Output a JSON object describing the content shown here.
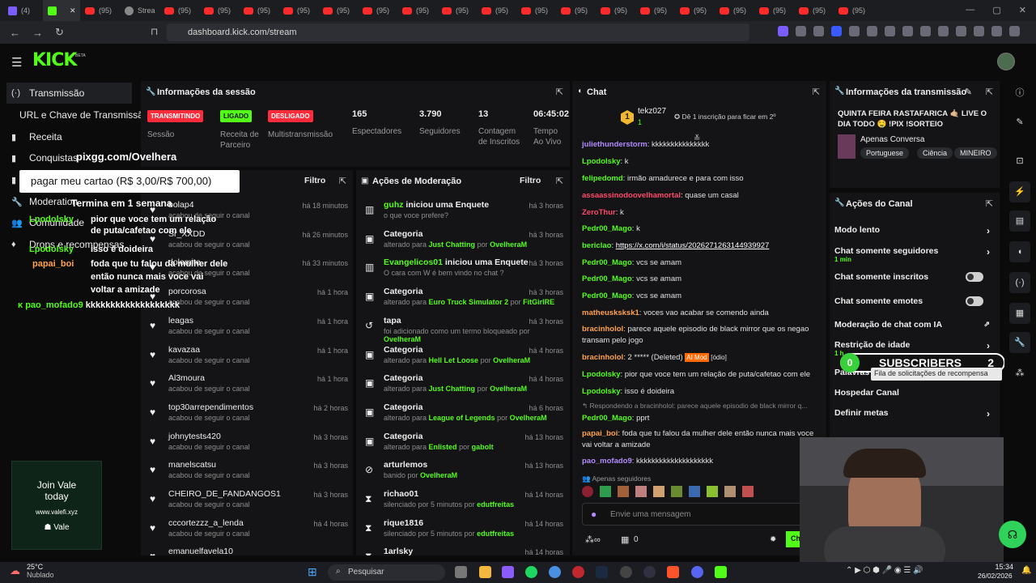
{
  "browser": {
    "tabs": [
      {
        "label": "(4)"
      },
      {
        "label": ""
      },
      {
        "label": "(95)"
      },
      {
        "label": "Strea"
      },
      {
        "label": "(95)"
      },
      {
        "label": "(95)"
      },
      {
        "label": "(95)"
      },
      {
        "label": "(95)"
      },
      {
        "label": "(95)"
      },
      {
        "label": "(95)"
      },
      {
        "label": "(95)"
      },
      {
        "label": "(95)"
      },
      {
        "label": "(95)"
      },
      {
        "label": "(95)"
      },
      {
        "label": "(95)"
      },
      {
        "label": "(95)"
      },
      {
        "label": "(95)"
      },
      {
        "label": "(95)"
      },
      {
        "label": "(95)"
      },
      {
        "label": "(95)"
      },
      {
        "label": "(95)"
      },
      {
        "label": "(95)"
      }
    ],
    "url": "dashboard.kick.com/stream"
  },
  "header": {
    "logo": "KICK",
    "beta": "BETA"
  },
  "sidebar": {
    "items": [
      {
        "label": "Transmissão",
        "icon": "(·)"
      },
      {
        "label": "URL e Chave de Transmissão",
        "icon": ""
      },
      {
        "label": "Receita",
        "icon": "▮"
      },
      {
        "label": "Conquistas",
        "icon": "▮"
      },
      {
        "label": "",
        "icon": "▮"
      },
      {
        "label": "Moderation",
        "icon": "🔧"
      },
      {
        "label": "Comunidade",
        "icon": "👥"
      },
      {
        "label": "Drops e recompensas",
        "icon": "♦"
      }
    ],
    "ad": {
      "line1": "Join Vale",
      "line2": "today",
      "line3": "www.valefi.xyz",
      "line4": "Vale"
    }
  },
  "overlay": {
    "pix": "pixgg.com/Ovelhera",
    "pay": "pagar meu cartao (R$ 3,00/R$ 700,00)",
    "countdown": "Termina em 1 semana",
    "chat": [
      {
        "u": "Lpodolsky",
        "m": "pior que voce tem um relação de puta/cafetao com ele"
      },
      {
        "u": "Lpodolsky",
        "m": "isso é doideira"
      },
      {
        "u": "papai_boi",
        "m": "foda que tu falou da mulher dele então nunca mais voce vai voltar a amizade"
      },
      {
        "u": "pao_mofado9",
        "m": "kkkkkkkkkkkkkkkkkkk"
      }
    ]
  },
  "session": {
    "title": "Informações da sessão",
    "badges": [
      "TRANSMITINDO",
      "LIGADO",
      "DESLIGADO"
    ],
    "labels": [
      "Sessão",
      "Receita de Parceiro",
      "Multistransmissão"
    ],
    "stats": [
      {
        "value": "165",
        "label": "Espectadores"
      },
      {
        "value": "3.790",
        "label": "Seguidores"
      },
      {
        "value": "13",
        "label": "Contagem de Inscritos"
      },
      {
        "value": "06:45:02",
        "label": "Tempo Ao Vivo"
      }
    ]
  },
  "followers": {
    "filter": "Filtro",
    "items": [
      {
        "name": "bolap4",
        "sub": "acabou de seguir o canal",
        "time": "há 18 minutos"
      },
      {
        "name": "Sr_XXDD",
        "sub": "acabou de seguir o canal",
        "time": "há 26 minutos"
      },
      {
        "name": "dolomite",
        "sub": "acabou de seguir o canal",
        "time": "há 33 minutos"
      },
      {
        "name": "porcorosa",
        "sub": "acabou de seguir o canal",
        "time": "há 1 hora"
      },
      {
        "name": "leagas",
        "sub": "acabou de seguir o canal",
        "time": "há 1 hora"
      },
      {
        "name": "kavazaa",
        "sub": "acabou de seguir o canal",
        "time": "há 1 hora"
      },
      {
        "name": "Al3moura",
        "sub": "acabou de seguir o canal",
        "time": "há 1 hora"
      },
      {
        "name": "top30arrependimentos",
        "sub": "acabou de seguir o canal",
        "time": "há 2 horas"
      },
      {
        "name": "johnytests420",
        "sub": "acabou de seguir o canal",
        "time": "há 3 horas"
      },
      {
        "name": "manelscatsu",
        "sub": "acabou de seguir o canal",
        "time": "há 3 horas"
      },
      {
        "name": "CHEIRO_DE_FANDANGOS1",
        "sub": "acabou de seguir o canal",
        "time": "há 3 horas"
      },
      {
        "name": "cccortezzz_a_lenda",
        "sub": "acabou de seguir o canal",
        "time": "há 4 horas"
      },
      {
        "name": "emanuelfavela10",
        "sub": "",
        "time": ""
      }
    ]
  },
  "mod": {
    "title": "Ações de Moderação",
    "filter": "Filtro",
    "items": [
      {
        "icon": "▥",
        "a": "guhz",
        "b": " iniciou uma Enquete",
        "sub": "o que voce prefere?",
        "time": "há 3 horas"
      },
      {
        "icon": "▣",
        "a": "",
        "b": "Categoria",
        "sub": "alterado para ",
        "s1": "Just Chatting",
        "s2": " por ",
        "s3": "OvelheraM",
        "time": "há 3 horas"
      },
      {
        "icon": "▥",
        "a": "Evangelicos01",
        "b": " iniciou uma Enquete",
        "sub": "O cara com W é bem vindo no chat ?",
        "time": "há 3 horas"
      },
      {
        "icon": "▣",
        "a": "",
        "b": "Categoria",
        "sub": "alterado para ",
        "s1": "Euro Truck Simulator 2",
        "s2": " por ",
        "s3": "FitGirlRE",
        "time": "há 3 horas"
      },
      {
        "icon": "↺",
        "a": "",
        "b": "tapa",
        "sub": "foi adicionado como um termo bloqueado por ",
        "s1": "OvelheraM",
        "time": "há 3 horas"
      },
      {
        "icon": "▣",
        "a": "",
        "b": "Categoria",
        "sub": "alterado para ",
        "s1": "Hell Let Loose",
        "s2": " por ",
        "s3": "OvelheraM",
        "time": "há 4 horas"
      },
      {
        "icon": "▣",
        "a": "",
        "b": "Categoria",
        "sub": "alterado para ",
        "s1": "Just Chatting",
        "s2": " por ",
        "s3": "OvelheraM",
        "time": "há 4 horas"
      },
      {
        "icon": "▣",
        "a": "",
        "b": "Categoria",
        "sub": "alterado para ",
        "s1": "League of Legends",
        "s2": " por ",
        "s3": "OvelheraM",
        "time": "há 6 horas"
      },
      {
        "icon": "▣",
        "a": "",
        "b": "Categoria",
        "sub": "alterado para ",
        "s1": "Enlisted",
        "s2": " por ",
        "s3": "gabolt",
        "time": "há 13 horas"
      },
      {
        "icon": "⊘",
        "a": "",
        "b": "arturlemos",
        "sub": "banido por ",
        "s1": "OvelheraM",
        "time": "há 13 horas"
      },
      {
        "icon": "⧗",
        "a": "",
        "b": "richao01",
        "sub": "silenciado por 5 minutos por ",
        "s1": "edutfreitas",
        "time": "há 14 horas"
      },
      {
        "icon": "⧗",
        "a": "",
        "b": "rique1816",
        "sub": "silenciado por 5 minutos por ",
        "s1": "edutfreitas",
        "time": "há 14 horas"
      },
      {
        "icon": "⧗",
        "a": "",
        "b": "1arlsky",
        "sub": "",
        "time": "há 14 horas"
      }
    ]
  },
  "chat": {
    "title": "Chat",
    "top_user": "tekz027",
    "top_rank": "1",
    "top_count": "1",
    "promo": "Dê 1 inscrição para ficar em 2º",
    "messages": [
      {
        "u": "juliethunderstorm",
        "c": "#b28bff",
        "m": "kkkkkkkkkkkkkkk"
      },
      {
        "u": "Lpodolsky",
        "c": "#53fc18",
        "m": "k"
      },
      {
        "u": "felipedomd",
        "c": "#53fc18",
        "m": "irmão amadurece e para com isso"
      },
      {
        "u": "assaassinodoovelhamortal",
        "c": "#ff4a6a",
        "m": "quase um casal"
      },
      {
        "u": "ZeroThur",
        "c": "#ff4a6a",
        "m": "k"
      },
      {
        "u": "Pedr00_Mago",
        "c": "#53fc18",
        "m": "k"
      },
      {
        "u": "bericlao",
        "c": "#53fc18",
        "m": "",
        "link": "https://x.com/i/status/2026271263144939927"
      },
      {
        "u": "Pedr00_Mago",
        "c": "#53fc18",
        "m": "vcs se amam"
      },
      {
        "u": "Pedr00_Mago",
        "c": "#53fc18",
        "m": "vcs se amam"
      },
      {
        "u": "Pedr00_Mago",
        "c": "#53fc18",
        "m": "vcs se amam"
      },
      {
        "u": "matheusksksk1",
        "c": "#ffa24a",
        "m": "voces vao acabar se comendo ainda"
      },
      {
        "u": "bracinholol",
        "c": "#ffa24a",
        "m": "parece aquele episodio de black mirror que os negao transam pelo jogo"
      },
      {
        "u": "bracinholol",
        "c": "#ffa24a",
        "m": "2 ***** (Deleted)",
        "tag": "AI Mod",
        "tag2": "[ódio]"
      },
      {
        "u": "Lpodolsky",
        "c": "#53fc18",
        "m": "pior que voce tem um relação de puta/cafetao com ele"
      },
      {
        "u": "Lpodolsky",
        "c": "#53fc18",
        "m": "isso é doideira"
      },
      {
        "u": "",
        "c": "#888",
        "m": "↰ Respondendo a bracinholol: parece aquele episodio de black mirror q..."
      },
      {
        "u": "Pedr00_Mago",
        "c": "#53fc18",
        "m": "pprt"
      },
      {
        "u": "papai_boi",
        "c": "#ffa24a",
        "m": "foda que tu falou da mulher dele então nunca mais voce vai voltar a amizade"
      },
      {
        "u": "pao_mofado9",
        "c": "#b28bff",
        "m": "kkkkkkkkkkkkkkkkkkkk"
      }
    ],
    "followers_only": "Apenas seguidores",
    "placeholder": "Envie uma mensagem",
    "count": "0",
    "chat_button": "Ch"
  },
  "stream_info": {
    "title": "Informações da transmissão",
    "stream_title": "QUINTA FEIRA RASTAFARICA 🤙🏼 LIVE O DIA TODO 🤤 !PIX !SORTEIO",
    "category": "Apenas Conversa",
    "tags": [
      "Portuguese",
      "Ciência",
      "MINEIRO"
    ]
  },
  "channel": {
    "title": "Ações do Canal",
    "rows": [
      {
        "label": "Modo lento",
        "sub": "",
        "ctrl": "arrow"
      },
      {
        "label": "Chat somente seguidores",
        "sub": "1 min",
        "ctrl": "arrow"
      },
      {
        "label": "Chat somente inscritos",
        "sub": "",
        "ctrl": "toggle"
      },
      {
        "label": "Chat somente emotes",
        "sub": "",
        "ctrl": "toggle"
      },
      {
        "label": "Moderação de chat com IA",
        "sub": "",
        "ctrl": "ext"
      },
      {
        "label": "Restrição de idade",
        "sub": "1 h",
        "ctrl": "arrow"
      },
      {
        "label": "Palavras",
        "sub": "",
        "ctrl": ""
      },
      {
        "label": "Hospedar Canal",
        "sub": "",
        "ctrl": ""
      },
      {
        "label": "Definir metas",
        "sub": "",
        "ctrl": "arrow"
      }
    ],
    "subs": {
      "left": "0",
      "label": "SUBSCRIBERS",
      "right": "2"
    },
    "tooltip": "Fila de solicitações de recompensa"
  },
  "taskbar": {
    "weather": "25°C",
    "weather_sub": "Nublado",
    "search": "Pesquisar",
    "time": "15:34",
    "date": "26/02/2026"
  }
}
